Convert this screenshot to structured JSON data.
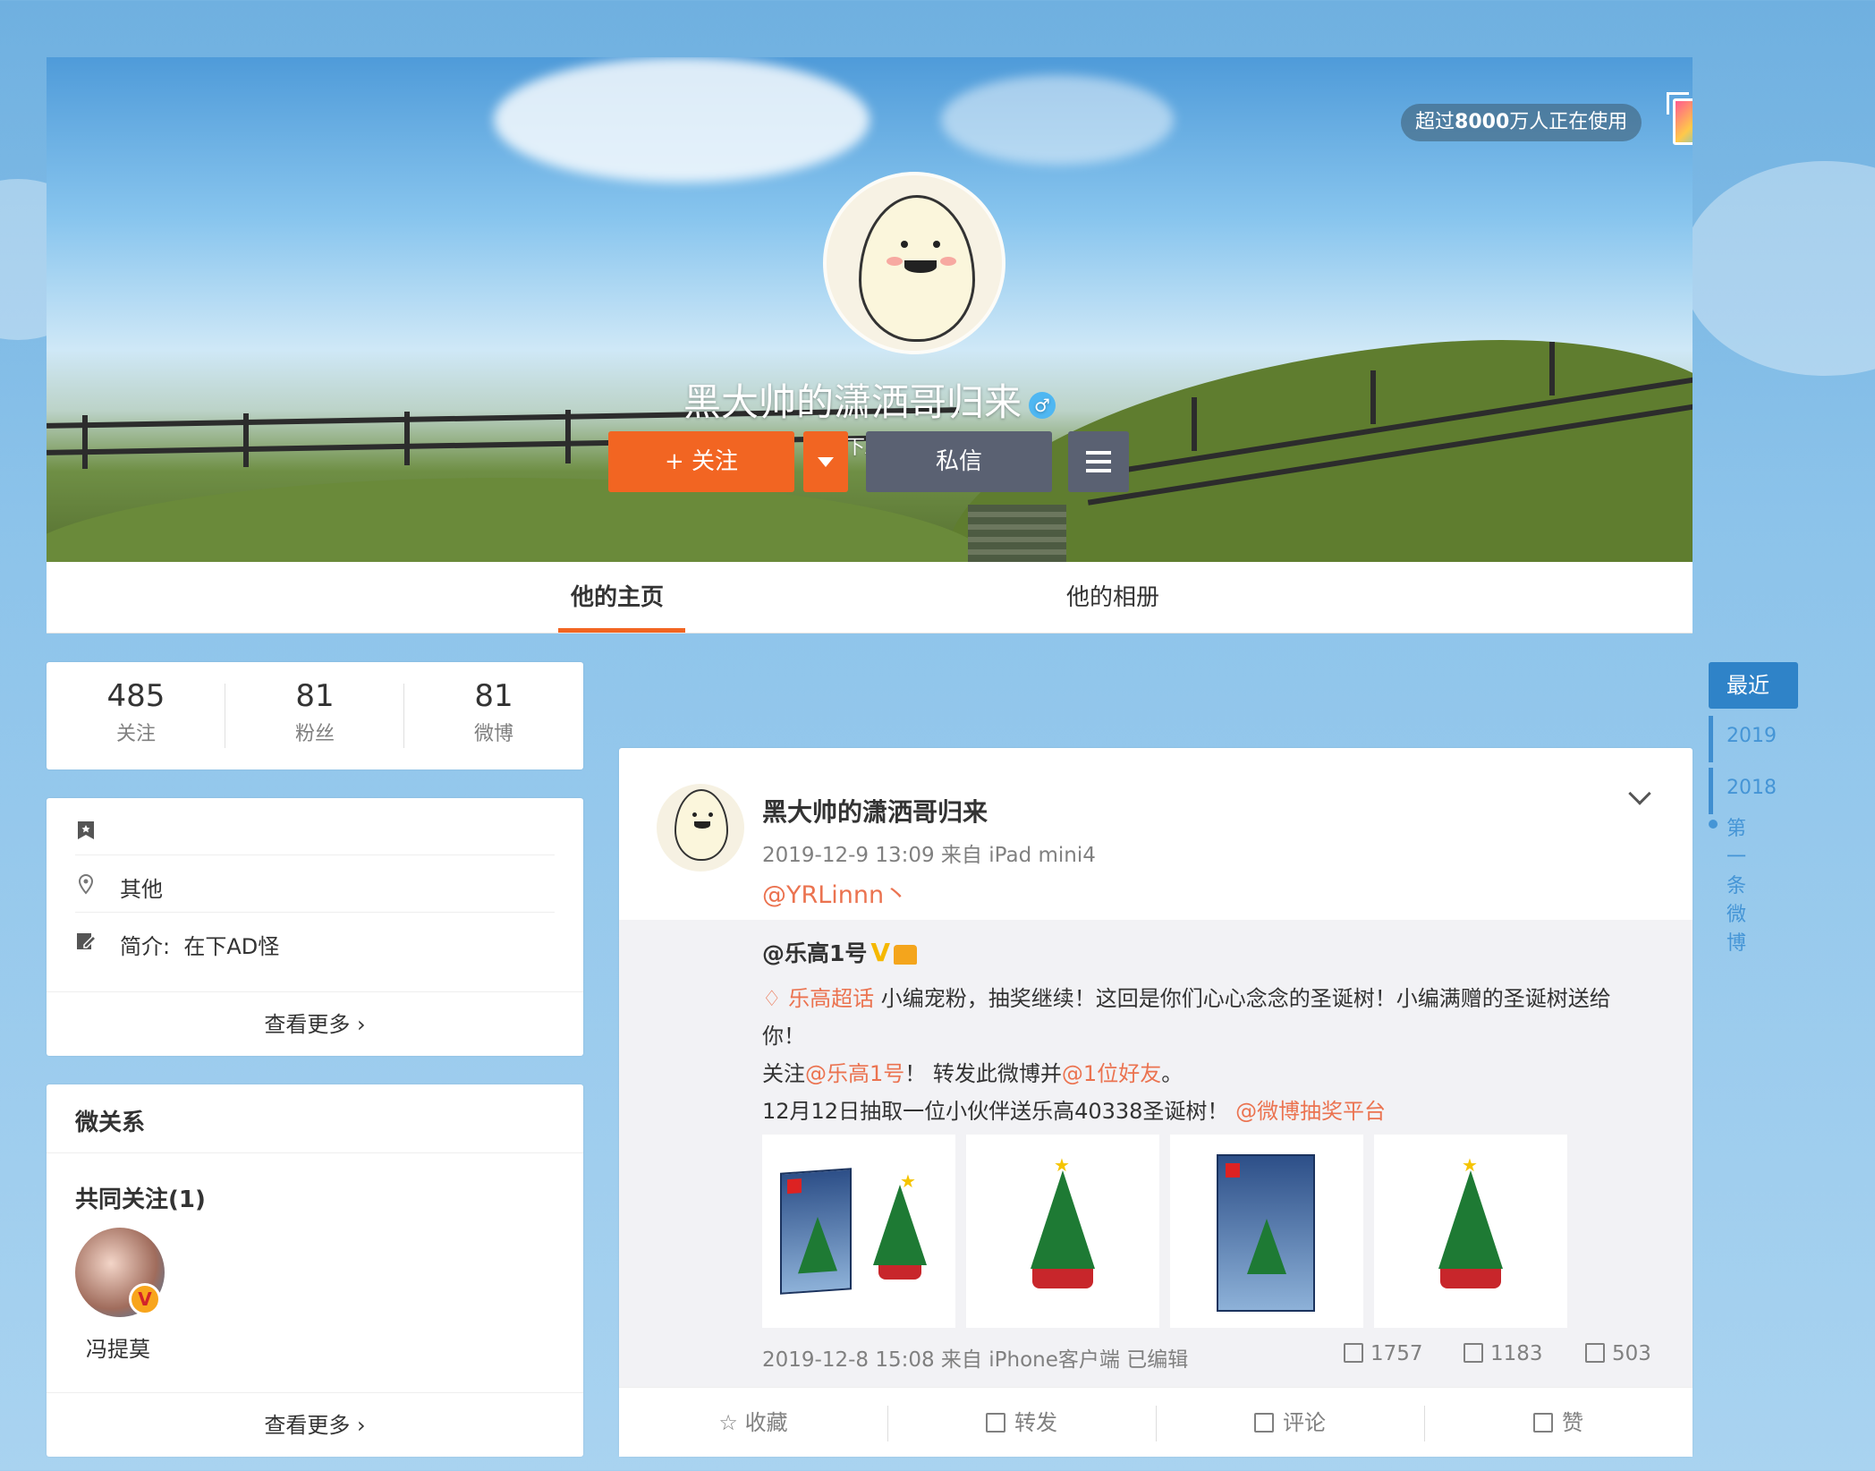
{
  "header": {
    "badge_prefix": "超过",
    "badge_count": "8000",
    "badge_suffix": "万人正在使用",
    "username": "黑大帅的潇洒哥归来",
    "gender_symbol": "♂",
    "bio": "在下AD怪",
    "follow_label": "+ 关注",
    "message_label": "私信"
  },
  "tabs": [
    {
      "label": "他的主页",
      "active": true
    },
    {
      "label": "他的相册",
      "active": false
    }
  ],
  "stats": [
    {
      "num": "485",
      "label": "关注"
    },
    {
      "num": "81",
      "label": "粉丝"
    },
    {
      "num": "81",
      "label": "微博"
    }
  ],
  "info": {
    "location": "其他",
    "bio_label": "简介:",
    "bio_value": "在下AD怪",
    "see_more": "查看更多"
  },
  "relations": {
    "title": "微关系",
    "common_follow": "共同关注(1)",
    "friend_name": "冯提莫",
    "friend_badge": "V",
    "see_more": "查看更多"
  },
  "timeline": {
    "recent": "最近",
    "years": [
      "2019",
      "2018"
    ],
    "first_post": "第一条微博"
  },
  "post": {
    "author": "黑大帅的潇洒哥归来",
    "meta": "2019-12-9 13:09 来自 iPad mini4",
    "at_text": "@YRLinnn丶",
    "repost": {
      "author": "@乐高1号",
      "v_mark": "V",
      "topic": "乐高超话",
      "line1_rest": " 小编宠粉，抽奖继续！这回是你们心心念念的圣诞树！小编满赠的圣诞树送给",
      "line2": "你！",
      "line3_pre": "关注",
      "line3_link1": "@乐高1号",
      "line3_mid": "！ 转发此微博并",
      "line3_link2": "@1位好友",
      "line3_end": "。",
      "line4_pre": "12月12日抽取一位小伙伴送乐高40338圣诞树！ ",
      "line4_link": "@微博抽奖平台",
      "footer": "2019-12-8 15:08 来自 iPhone客户端   已编辑",
      "reposts": "1757",
      "comments": "1183",
      "likes": "503"
    },
    "actions": {
      "collect": "收藏",
      "repost": "转发",
      "comment": "评论",
      "like": "赞"
    }
  }
}
